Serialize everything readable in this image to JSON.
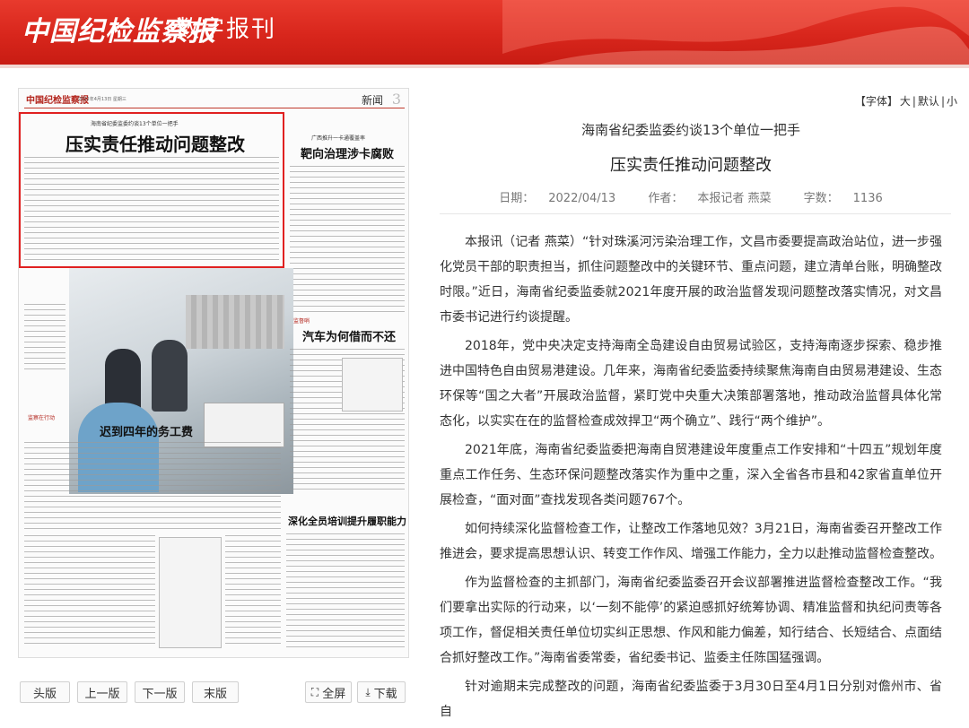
{
  "header": {
    "brand": "中国纪检监察报",
    "subtitle": "数字报刊"
  },
  "paper": {
    "logo": "中国纪检监察报",
    "date": "2022年4月13日  星期三",
    "section": "新闻",
    "page_no": "3",
    "lead_subtitle": "海南省纪委监委约谈13个单位一把手",
    "lead_title": "压实责任推动问题整改",
    "story2_kicker": "广西推升一卡通覆盖率",
    "story2_title": "靶向治理涉卡腐败",
    "story3_col": "监督哨",
    "story3_title": "汽车为何借而不还",
    "story4_col": "监察在行动",
    "story4_title": "迟到四年的务工费",
    "story5_title": "深化全员培训提升履职能力"
  },
  "controls": {
    "first": "头版",
    "prev": "上一版",
    "next": "下一版",
    "last": "末版",
    "fullscreen": "全屏",
    "download": "下载"
  },
  "font_size": {
    "label": "【字体】",
    "large": "大",
    "default": "默认",
    "small": "小"
  },
  "article": {
    "subtitle": "海南省纪委监委约谈13个单位一把手",
    "title": "压实责任推动问题整改",
    "date_label": "日期：",
    "date": "2022/04/13",
    "author_label": "作者：",
    "author": "本报记者 燕菜",
    "words_label": "字数：",
    "words": "1136",
    "paragraphs": [
      "本报讯（记者 燕菜）“针对珠溪河污染治理工作，文昌市委要提高政治站位，进一步强化党员干部的职责担当，抓住问题整改中的关键环节、重点问题，建立清单台账，明确整改时限。”近日，海南省纪委监委就2021年度开展的政治监督发现问题整改落实情况，对文昌市委书记进行约谈提醒。",
      "2018年，党中央决定支持海南全岛建设自由贸易试验区，支持海南逐步探索、稳步推进中国特色自由贸易港建设。几年来，海南省纪委监委持续聚焦海南自由贸易港建设、生态环保等“国之大者”开展政治监督，紧盯党中央重大决策部署落地，推动政治监督具体化常态化，以实实在在的监督检查成效捍卫“两个确立”、践行“两个维护”。",
      "2021年底，海南省纪委监委把海南自贸港建设年度重点工作安排和“十四五”规划年度重点工作任务、生态环保问题整改落实作为重中之重，深入全省各市县和42家省直单位开展检查，“面对面”查找发现各类问题767个。",
      "如何持续深化监督检查工作，让整改工作落地见效？3月21日，海南省委召开整改工作推进会，要求提高思想认识、转变工作作风、增强工作能力，全力以赴推动监督检查整改。",
      "作为监督检查的主抓部门，海南省纪委监委召开会议部署推进监督检查整改工作。“我们要拿出实际的行动来，以‘一刻不能停’的紧迫感抓好统筹协调、精准监督和执纪问责等各项工作，督促相关责任单位切实纠正思想、作风和能力偏差，知行结合、长短结合、点面结合抓好整改工作。”海南省委常委，省纪委书记、监委主任陈国猛强调。",
      "针对逾期未完成整改的问题，海南省纪委监委于3月30日至4月1日分别对儋州市、省自"
    ]
  }
}
